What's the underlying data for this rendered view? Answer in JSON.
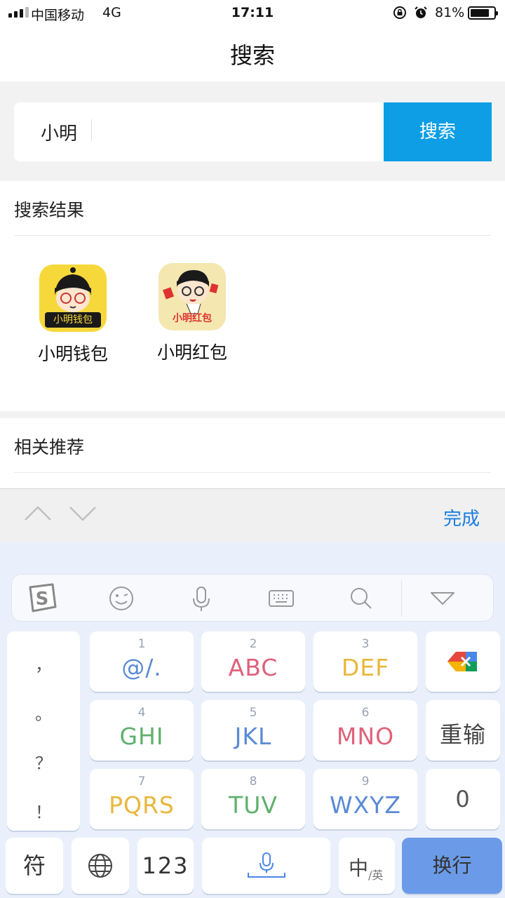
{
  "status_bar": {
    "carrier": "中国移动",
    "network": "4G",
    "time": "17:11",
    "battery_percent": "81%",
    "battery_level": 0.81
  },
  "nav": {
    "title": "搜索"
  },
  "search": {
    "value": "小明",
    "button_label": "搜索"
  },
  "results": {
    "title": "搜索结果",
    "apps": [
      {
        "name": "小明钱包",
        "icon_text": "小明钱包",
        "icon": "xiaoming-wallet-icon"
      },
      {
        "name": "小明红包",
        "icon_text": "小明红包",
        "icon": "xiaoming-redpacket-icon"
      }
    ]
  },
  "related": {
    "title": "相关推荐"
  },
  "accessory_bar": {
    "done_label": "完成"
  },
  "keyboard": {
    "toolbar_icons": [
      "sogou-logo-icon",
      "emoji-icon",
      "microphone-icon",
      "keyboard-icon",
      "search-icon",
      "collapse-icon"
    ],
    "punctuation": [
      "，",
      "。",
      "？",
      "！"
    ],
    "keys": [
      {
        "num": "1",
        "letters": "@/.",
        "color": "#5a8ad6"
      },
      {
        "num": "2",
        "letters": "ABC",
        "color": "#e0607a"
      },
      {
        "num": "3",
        "letters": "DEF",
        "color": "#e8b73c"
      },
      {
        "num": "4",
        "letters": "GHI",
        "color": "#5fb06c"
      },
      {
        "num": "5",
        "letters": "JKL",
        "color": "#5a8ad6"
      },
      {
        "num": "6",
        "letters": "MNO",
        "color": "#e0607a"
      },
      {
        "num": "7",
        "letters": "PQRS",
        "color": "#e8b73c"
      },
      {
        "num": "8",
        "letters": "TUV",
        "color": "#5fb06c"
      },
      {
        "num": "9",
        "letters": "WXYZ",
        "color": "#5a8ad6"
      }
    ],
    "reinput_label": "重输",
    "zero_label": "0",
    "symbol_label": "符",
    "numbers_label": "123",
    "lang_main": "中",
    "lang_sub": "/英",
    "enter_label": "换行"
  }
}
